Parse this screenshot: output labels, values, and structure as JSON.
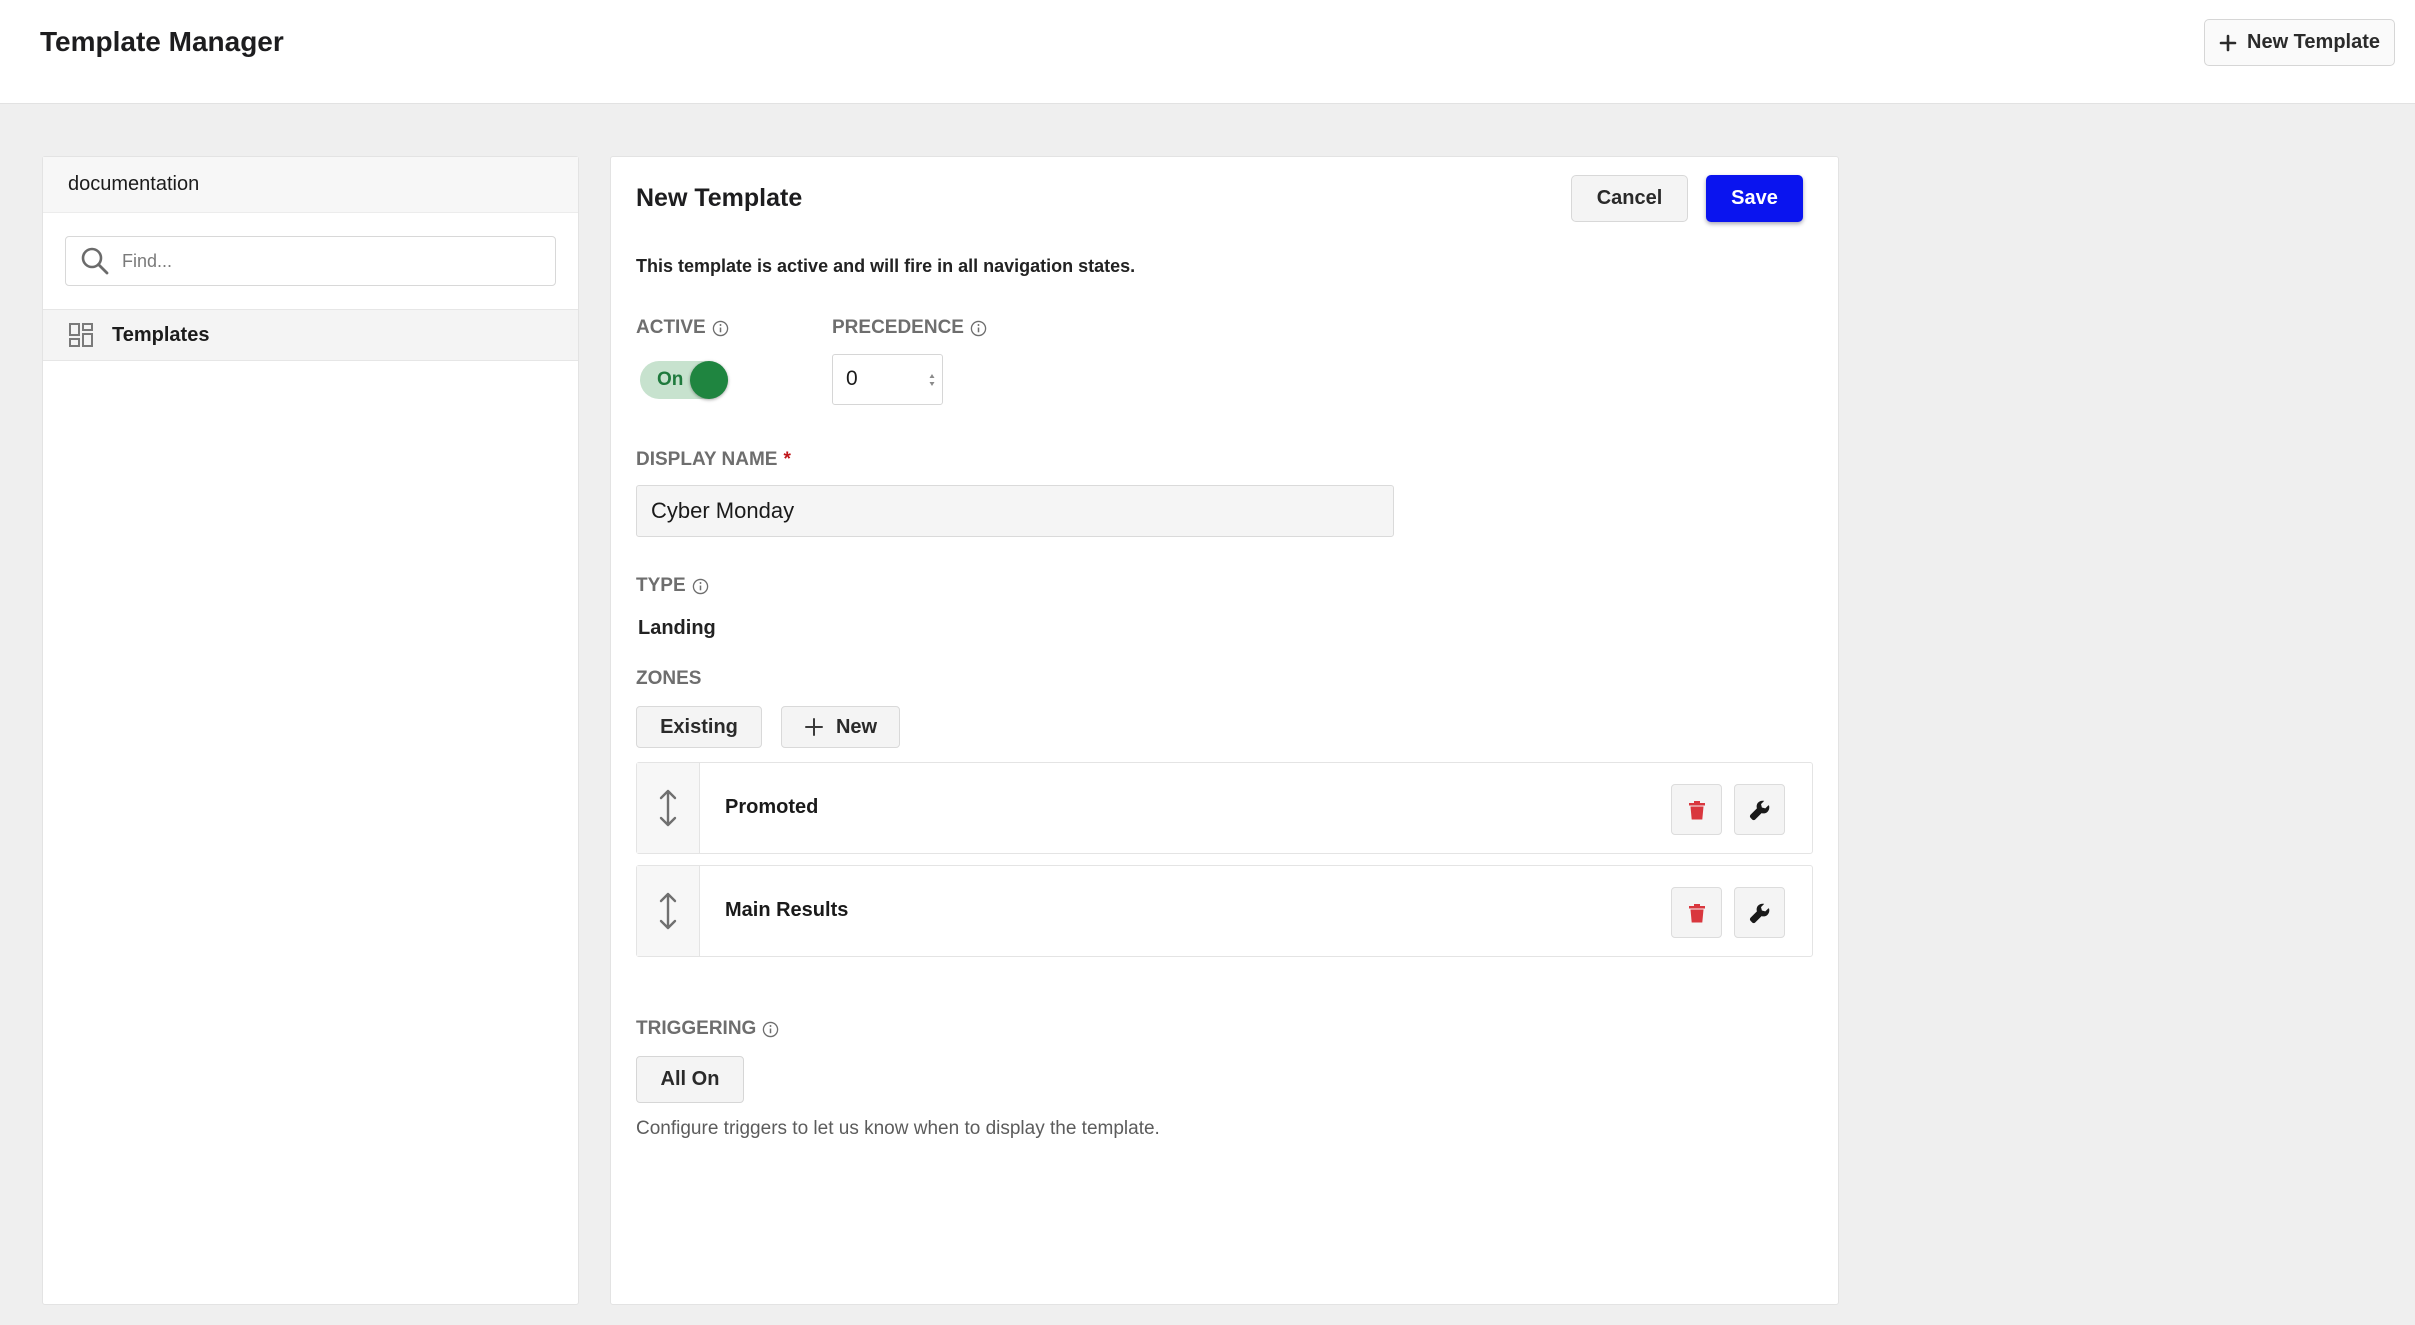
{
  "header": {
    "title": "Template Manager",
    "new_template_label": "New Template"
  },
  "sidebar": {
    "heading": "documentation",
    "search_placeholder": "Find...",
    "items": [
      {
        "label": "Templates",
        "icon": "grid-icon"
      }
    ]
  },
  "form": {
    "title": "New Template",
    "cancel_label": "Cancel",
    "save_label": "Save",
    "notice": "This template is active and will fire in all navigation states.",
    "active": {
      "label": "ACTIVE",
      "toggle_text": "On",
      "value": true
    },
    "precedence": {
      "label": "PRECEDENCE",
      "value": "0"
    },
    "display_name": {
      "label": "DISPLAY NAME",
      "required_mark": "*",
      "value": "Cyber Monday"
    },
    "type": {
      "label": "TYPE",
      "value": "Landing"
    },
    "zones": {
      "label": "ZONES",
      "existing_label": "Existing",
      "new_label": "New",
      "items": [
        {
          "name": "Promoted"
        },
        {
          "name": "Main Results"
        }
      ]
    },
    "triggering": {
      "label": "TRIGGERING",
      "button_label": "All On",
      "help": "Configure triggers to let us know when to display the template."
    }
  },
  "colors": {
    "primary": "#0a14ef",
    "toggle_on": "#1f8540",
    "toggle_track": "#c7e2ce",
    "delete_icon": "#d9373e",
    "required": "#c0151a"
  }
}
